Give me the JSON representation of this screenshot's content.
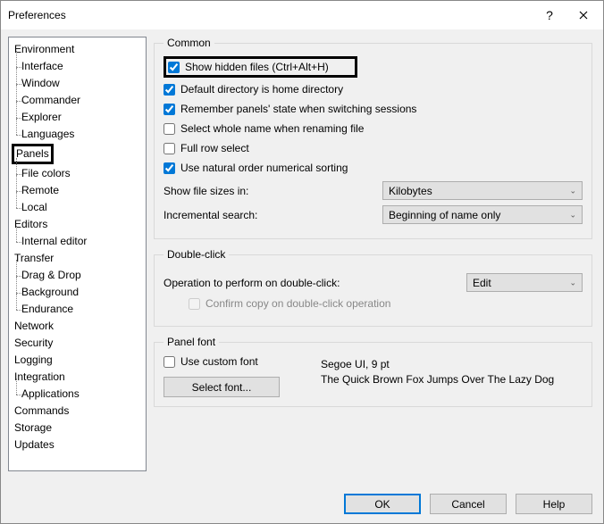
{
  "title": "Preferences",
  "tree": {
    "environment": "Environment",
    "interface": "Interface",
    "window": "Window",
    "commander": "Commander",
    "explorer": "Explorer",
    "languages": "Languages",
    "panels": "Panels",
    "filecolors": "File colors",
    "remote": "Remote",
    "local": "Local",
    "editors": "Editors",
    "internaleditor": "Internal editor",
    "transfer": "Transfer",
    "dragdrop": "Drag & Drop",
    "background": "Background",
    "endurance": "Endurance",
    "network": "Network",
    "security": "Security",
    "logging": "Logging",
    "integration": "Integration",
    "applications": "Applications",
    "commands": "Commands",
    "storage": "Storage",
    "updates": "Updates"
  },
  "common": {
    "legend": "Common",
    "show_hidden": "Show hidden files (Ctrl+Alt+H)",
    "default_dir": "Default directory is home directory",
    "remember_panels": "Remember panels' state when switching sessions",
    "select_whole": "Select whole name when renaming file",
    "full_row": "Full row select",
    "natural_order": "Use natural order numerical sorting",
    "show_sizes_label": "Show file sizes in:",
    "show_sizes_value": "Kilobytes",
    "inc_search_label": "Incremental search:",
    "inc_search_value": "Beginning of name only"
  },
  "dblclick": {
    "legend": "Double-click",
    "op_label": "Operation to perform on double-click:",
    "op_value": "Edit",
    "confirm": "Confirm copy on double-click operation"
  },
  "panelfont": {
    "legend": "Panel font",
    "use_custom": "Use custom font",
    "select_font": "Select font...",
    "sample_name": "Segoe UI, 9 pt",
    "sample_text": "The Quick Brown Fox Jumps Over The Lazy Dog"
  },
  "buttons": {
    "ok": "OK",
    "cancel": "Cancel",
    "help": "Help"
  }
}
